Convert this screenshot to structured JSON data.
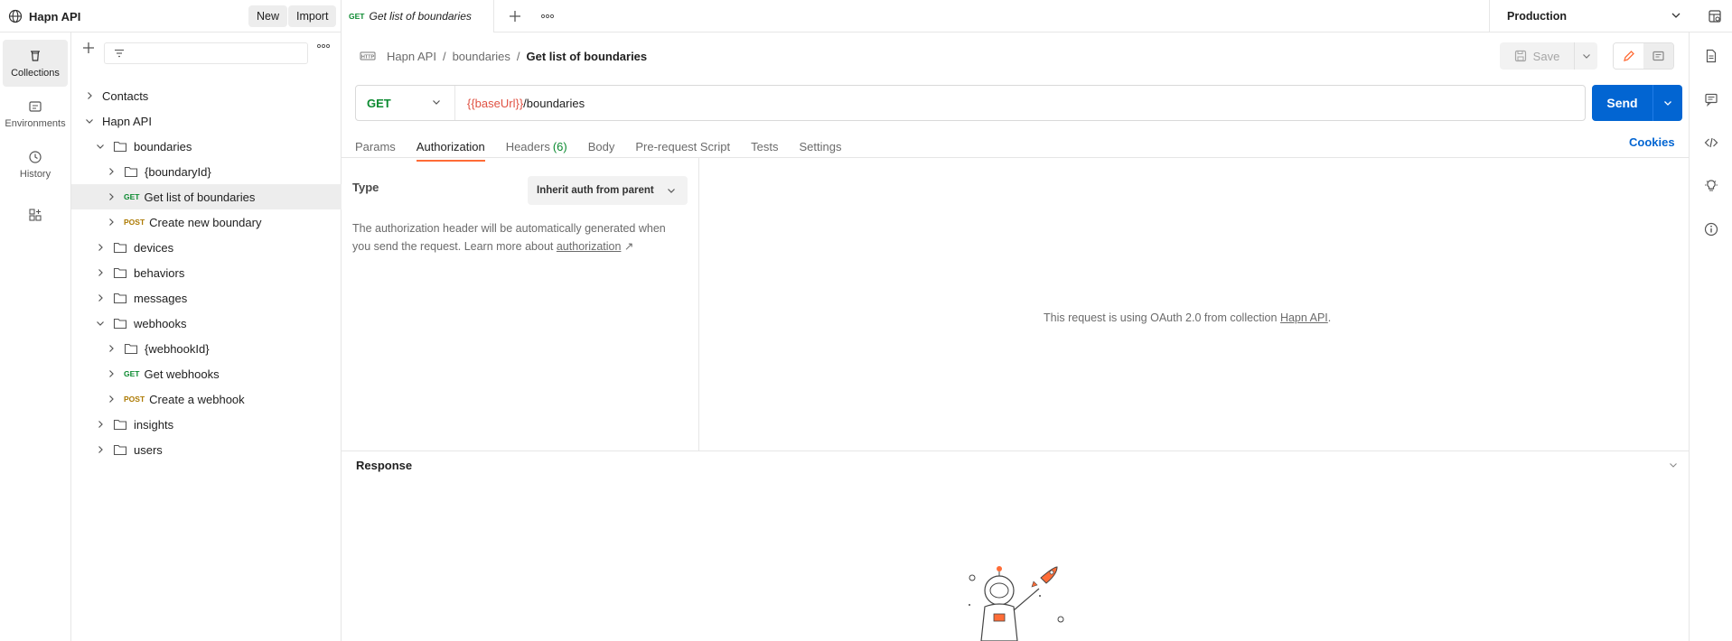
{
  "workspace": {
    "name": "Hapn API",
    "new_label": "New",
    "import_label": "Import"
  },
  "tabs": {
    "active": {
      "method": "GET",
      "name": "Get list of boundaries"
    }
  },
  "environment": {
    "selected": "Production"
  },
  "rail": {
    "collections": "Collections",
    "environments": "Environments",
    "history": "History"
  },
  "sidebar": {
    "tree": [
      {
        "label": "Contacts",
        "type": "collection",
        "depth": 0,
        "expanded": false
      },
      {
        "label": "Hapn API",
        "type": "collection",
        "depth": 0,
        "expanded": true
      },
      {
        "label": "boundaries",
        "type": "folder",
        "depth": 1,
        "expanded": true
      },
      {
        "label": "{boundaryId}",
        "type": "folder",
        "depth": 2,
        "expanded": false
      },
      {
        "label": "Get list of boundaries",
        "type": "request",
        "method": "GET",
        "depth": 2,
        "selected": true
      },
      {
        "label": "Create new boundary",
        "type": "request",
        "method": "POST",
        "depth": 2
      },
      {
        "label": "devices",
        "type": "folder",
        "depth": 1,
        "expanded": false
      },
      {
        "label": "behaviors",
        "type": "folder",
        "depth": 1,
        "expanded": false
      },
      {
        "label": "messages",
        "type": "folder",
        "depth": 1,
        "expanded": false
      },
      {
        "label": "webhooks",
        "type": "folder",
        "depth": 1,
        "expanded": true
      },
      {
        "label": "{webhookId}",
        "type": "folder",
        "depth": 2,
        "expanded": false
      },
      {
        "label": "Get webhooks",
        "type": "request",
        "method": "GET",
        "depth": 2
      },
      {
        "label": "Create a webhook",
        "type": "request",
        "method": "POST",
        "depth": 2
      },
      {
        "label": "insights",
        "type": "folder",
        "depth": 1,
        "expanded": false
      },
      {
        "label": "users",
        "type": "folder",
        "depth": 1,
        "expanded": false
      }
    ]
  },
  "breadcrumb": {
    "root": "Hapn API",
    "folder": "boundaries",
    "current": "Get list of boundaries"
  },
  "toolbar": {
    "save_label": "Save"
  },
  "request": {
    "method": "GET",
    "url_var": "{{baseUrl}}",
    "url_path": "/boundaries",
    "send_label": "Send"
  },
  "request_tabs": [
    {
      "label": "Params"
    },
    {
      "label": "Authorization",
      "active": true
    },
    {
      "label": "Headers",
      "count": "(6)"
    },
    {
      "label": "Body"
    },
    {
      "label": "Pre-request Script"
    },
    {
      "label": "Tests"
    },
    {
      "label": "Settings"
    }
  ],
  "cookies_label": "Cookies",
  "auth": {
    "type_label": "Type",
    "type_value": "Inherit auth from parent",
    "description": "The authorization header will be automatically generated when you send the request. Learn more about",
    "link": "authorization",
    "link_arrow": "↗",
    "oauth_prefix": "This request is using OAuth 2.0 from collection",
    "oauth_collection": "Hapn API",
    "oauth_suffix": "."
  },
  "response": {
    "title": "Response"
  },
  "colors": {
    "accent": "#ff6c37",
    "send": "#0265d2",
    "get": "#0b8a30",
    "post": "#ad7a03",
    "var": "#e05243"
  }
}
